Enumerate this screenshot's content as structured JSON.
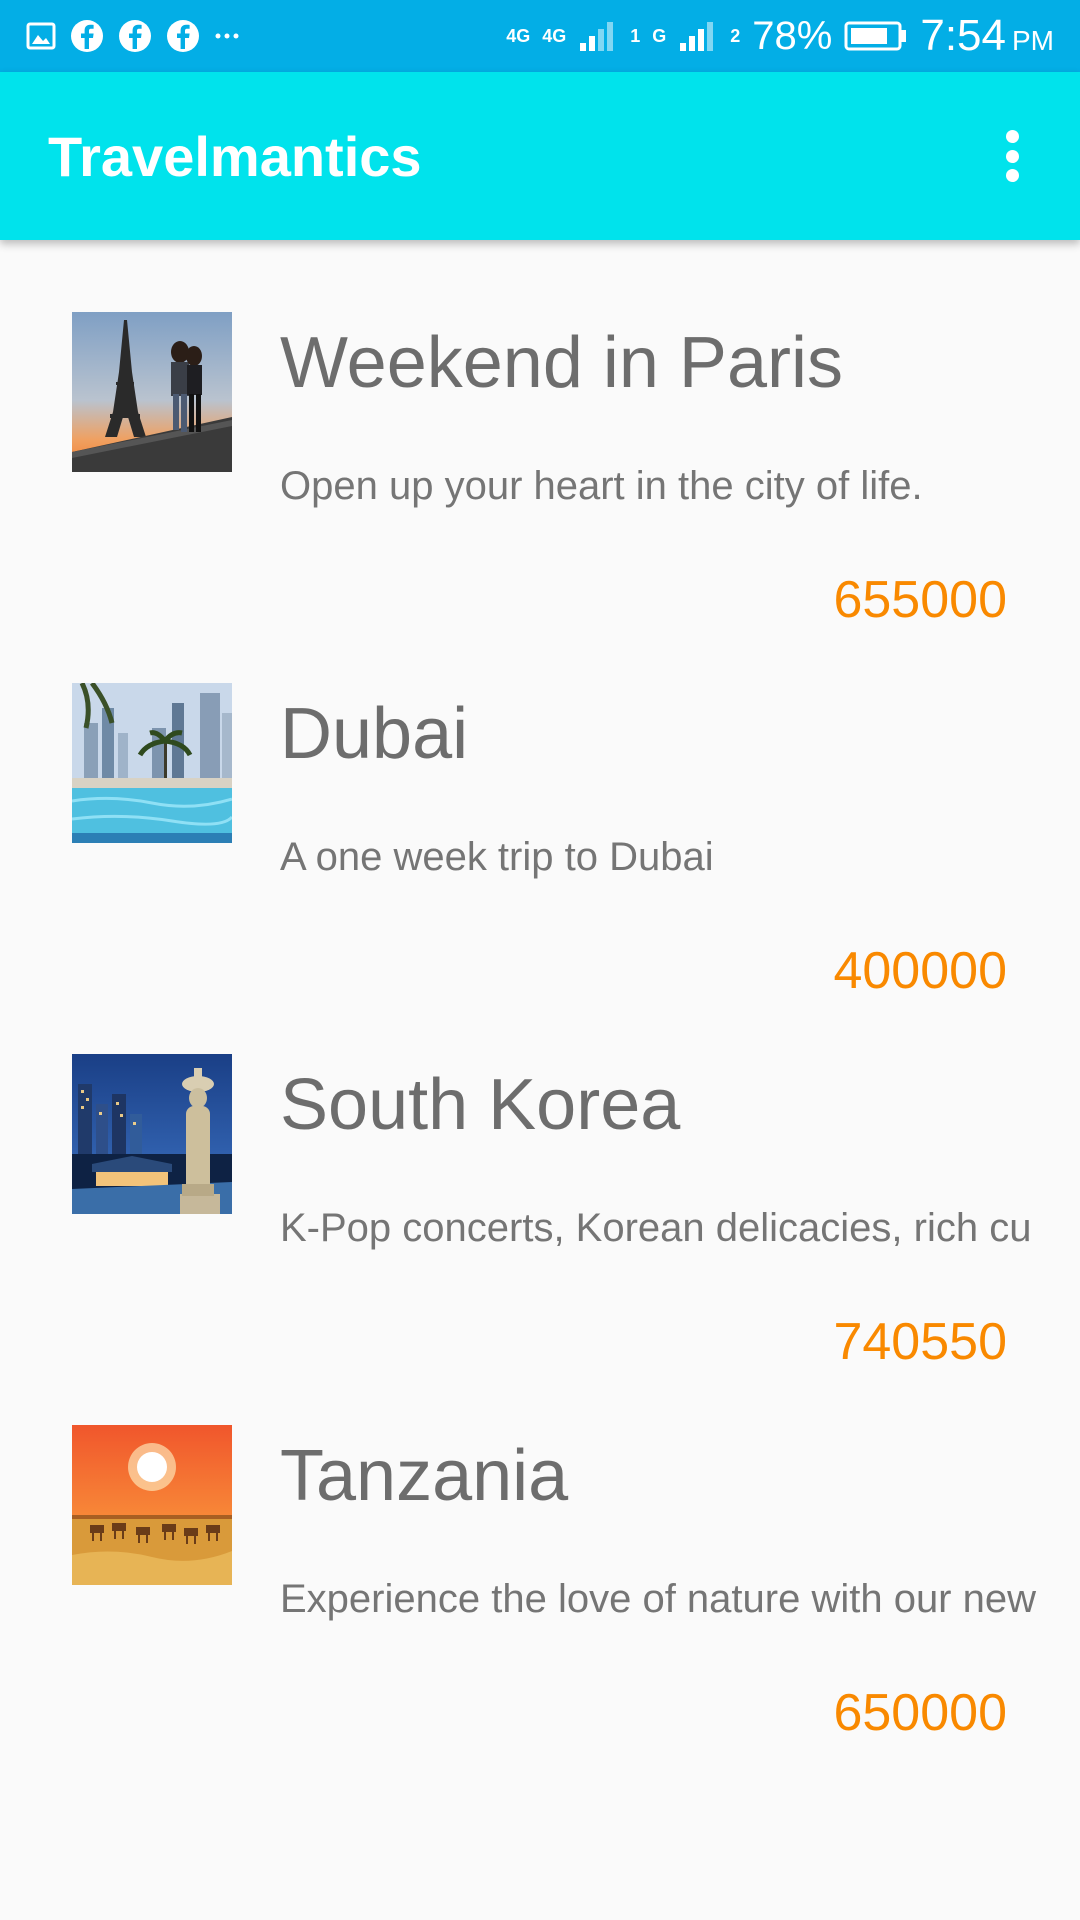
{
  "status_bar": {
    "network_1": "4G",
    "network_2": "4G",
    "sim_1": "1",
    "network_3": "G",
    "sim_2": "2",
    "battery": "78%",
    "time": "7:54",
    "ampm": "PM",
    "notification_icons": [
      "gallery-icon",
      "facebook-icon",
      "facebook-icon",
      "facebook-icon",
      "more-dots-icon"
    ]
  },
  "app_bar": {
    "title": "Travelmantics",
    "menu_icon": "overflow-menu-icon"
  },
  "deals": [
    {
      "title": "Weekend in Paris",
      "description": "Open up your heart in the city of life.",
      "price": "655000",
      "image": "paris-eiffel-tower-image"
    },
    {
      "title": "Dubai",
      "description": "A one week trip to Dubai",
      "price": "400000",
      "image": "dubai-pool-skyline-image"
    },
    {
      "title": "South Korea",
      "description": "K-Pop concerts, Korean delicacies, rich cu",
      "price": "740550",
      "image": "south-korea-night-city-image"
    },
    {
      "title": "Tanzania",
      "description": "Experience the love of nature with our new",
      "price": "650000",
      "image": "tanzania-sunset-zebras-image"
    }
  ],
  "colors": {
    "status_bar": "#03aee6",
    "app_bar": "#00e3ec",
    "background": "#fafafa",
    "title_text": "#6d6d6d",
    "price_text": "#f98900"
  }
}
